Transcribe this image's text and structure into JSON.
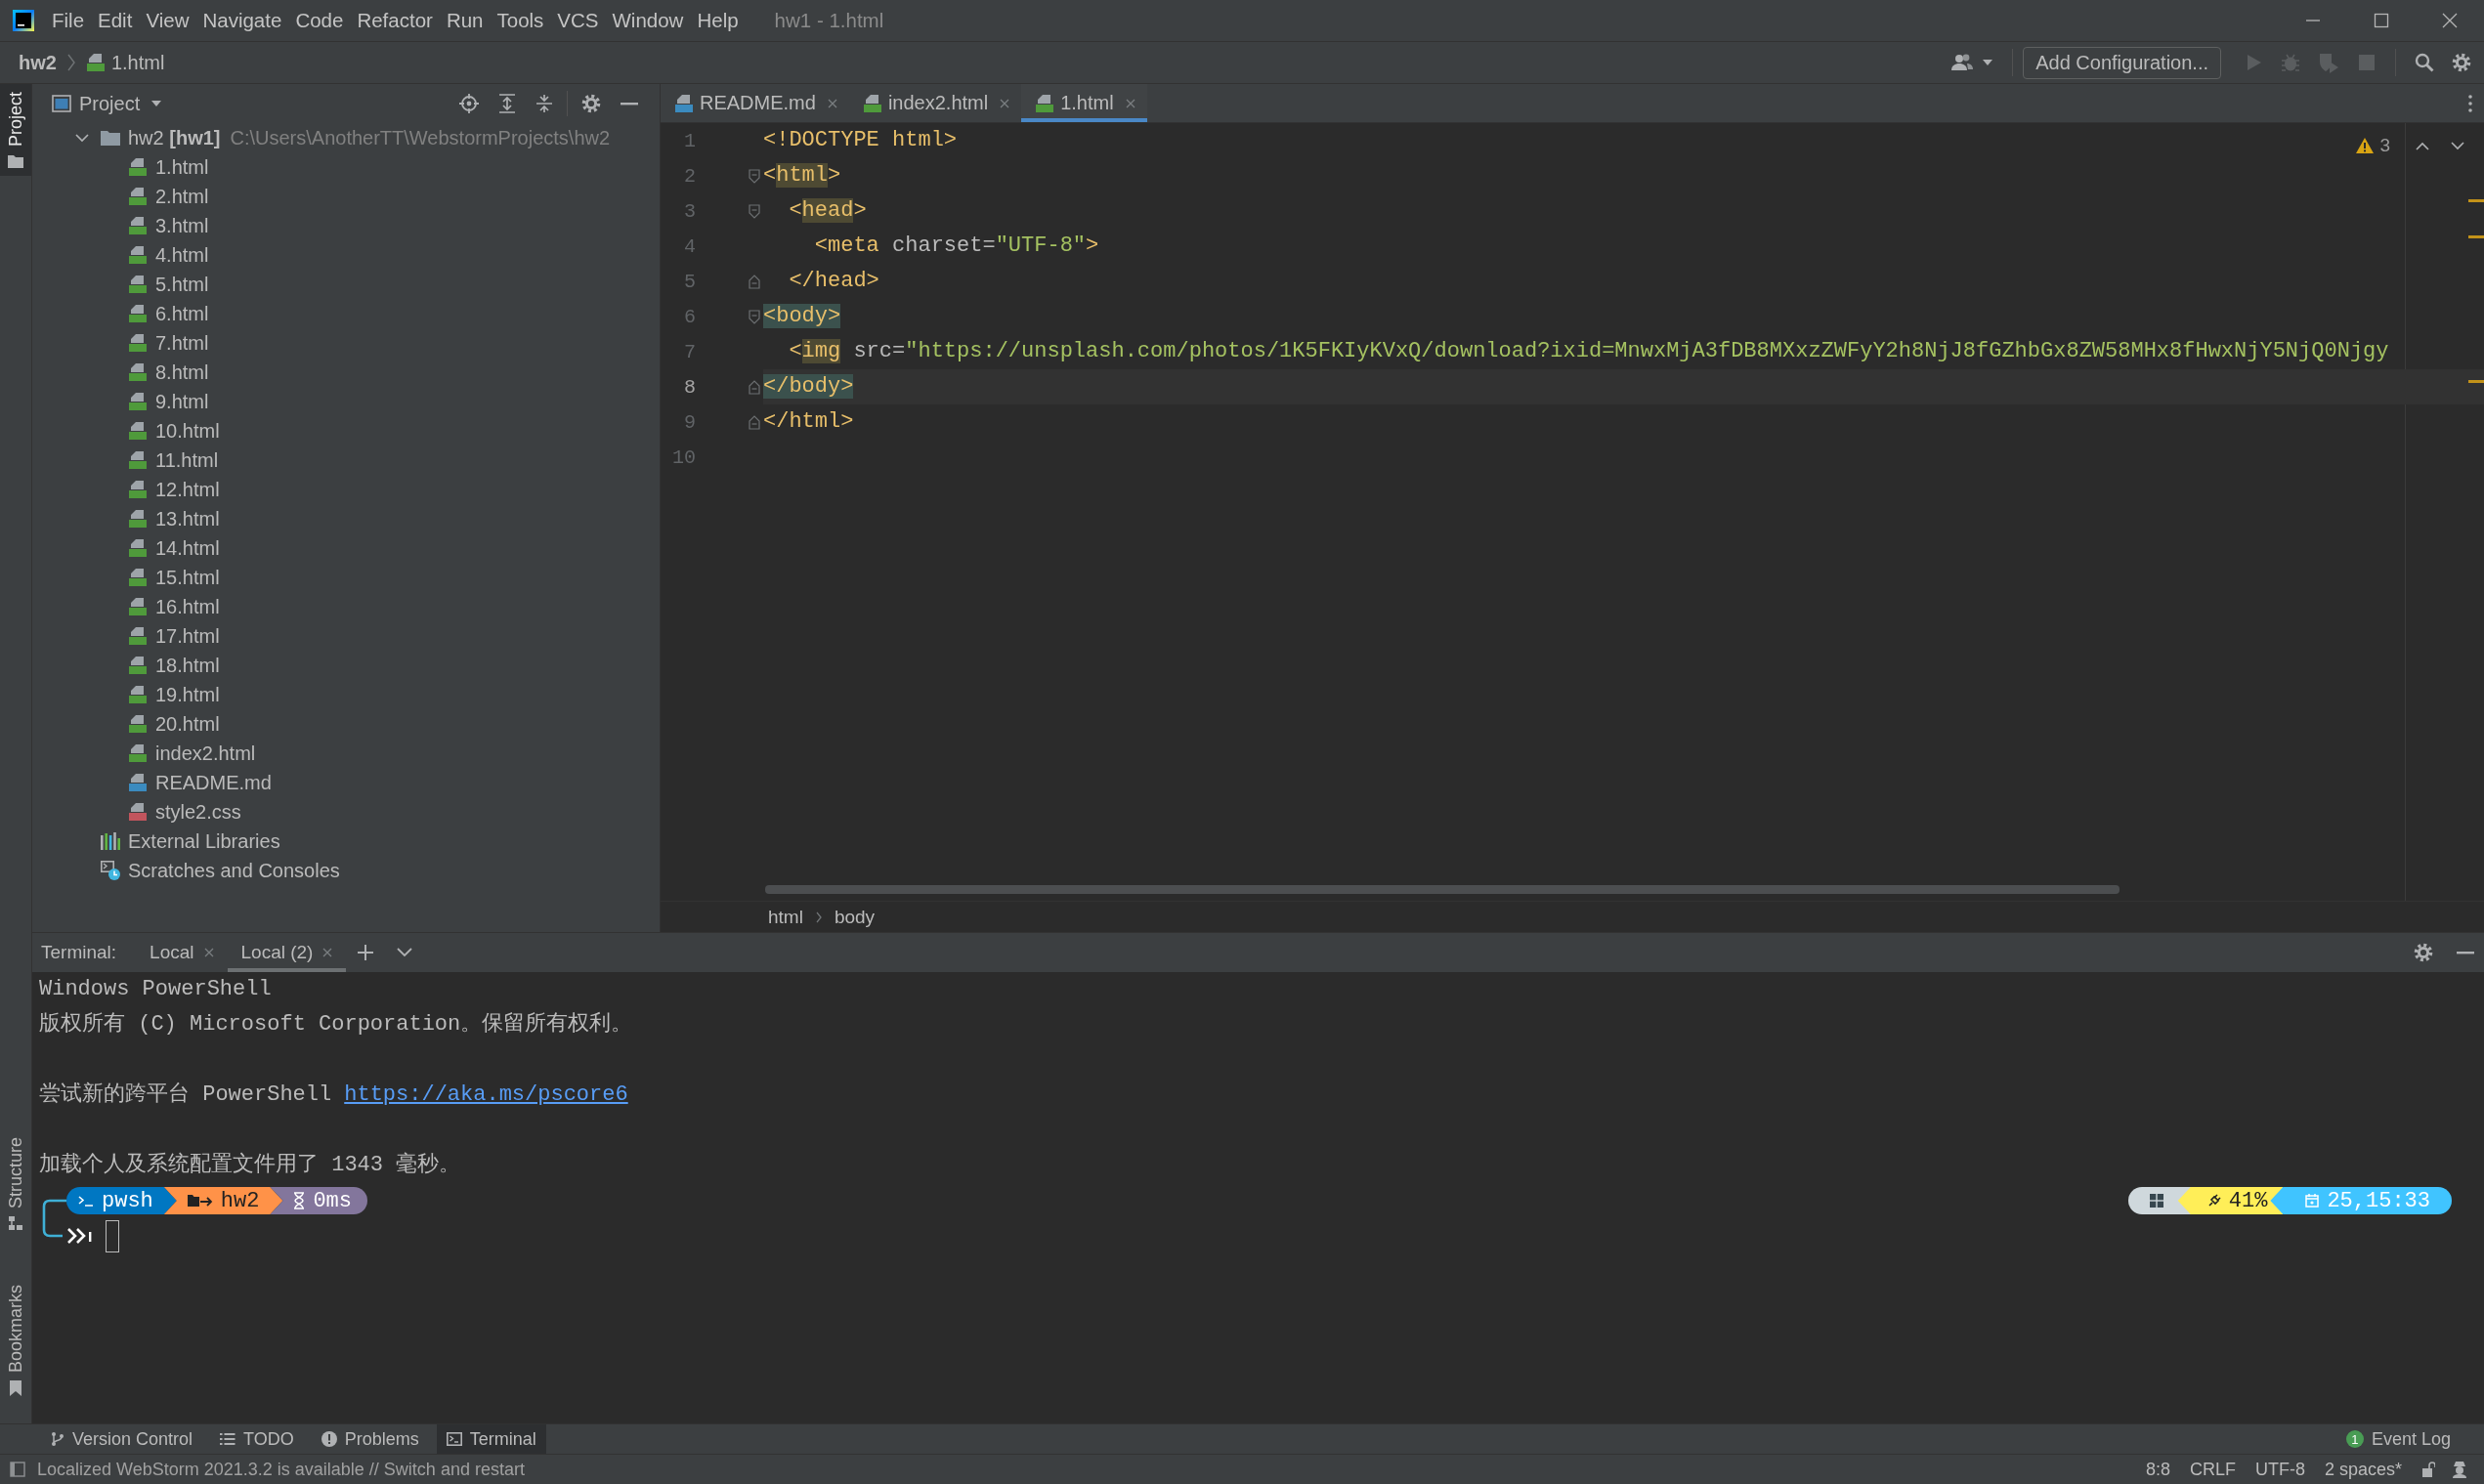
{
  "title_bar": {
    "menus": [
      "File",
      "Edit",
      "View",
      "Navigate",
      "Code",
      "Refactor",
      "Run",
      "Tools",
      "VCS",
      "Window",
      "Help"
    ],
    "title": "hw1 - 1.html"
  },
  "nav_bar": {
    "breadcrumb": [
      {
        "label": "hw2",
        "kind": "project"
      },
      {
        "label": "1.html",
        "kind": "html"
      }
    ],
    "run_configuration": "Add Configuration..."
  },
  "tool_window_stripe": {
    "top": [
      {
        "label": "Project",
        "kind": "project",
        "selected": true
      }
    ],
    "bottom": [
      {
        "label": "Structure",
        "kind": "structure",
        "selected": false
      },
      {
        "label": "Bookmarks",
        "kind": "bookmarks",
        "selected": false
      }
    ]
  },
  "project_panel": {
    "title": "Project",
    "tree": [
      {
        "name": "hw2 **[hw1]**",
        "path": "C:\\Users\\AnotherTT\\WebstormProjects\\hw2",
        "kind": "folder",
        "expanded": true,
        "children": [
          {
            "name": "1.html",
            "kind": "html"
          },
          {
            "name": "2.html",
            "kind": "html"
          },
          {
            "name": "3.html",
            "kind": "html"
          },
          {
            "name": "4.html",
            "kind": "html"
          },
          {
            "name": "5.html",
            "kind": "html"
          },
          {
            "name": "6.html",
            "kind": "html"
          },
          {
            "name": "7.html",
            "kind": "html"
          },
          {
            "name": "8.html",
            "kind": "html"
          },
          {
            "name": "9.html",
            "kind": "html"
          },
          {
            "name": "10.html",
            "kind": "html"
          },
          {
            "name": "11.html",
            "kind": "html"
          },
          {
            "name": "12.html",
            "kind": "html"
          },
          {
            "name": "13.html",
            "kind": "html"
          },
          {
            "name": "14.html",
            "kind": "html"
          },
          {
            "name": "15.html",
            "kind": "html"
          },
          {
            "name": "16.html",
            "kind": "html"
          },
          {
            "name": "17.html",
            "kind": "html"
          },
          {
            "name": "18.html",
            "kind": "html"
          },
          {
            "name": "19.html",
            "kind": "html"
          },
          {
            "name": "20.html",
            "kind": "html"
          },
          {
            "name": "index2.html",
            "kind": "html"
          },
          {
            "name": "README.md",
            "kind": "md"
          },
          {
            "name": "style2.css",
            "kind": "css"
          }
        ]
      },
      {
        "name": "External Libraries",
        "kind": "libraries"
      },
      {
        "name": "Scratches and Consoles",
        "kind": "scratches"
      }
    ]
  },
  "editor": {
    "tabs": [
      {
        "label": "README.md",
        "kind": "md",
        "selected": false
      },
      {
        "label": "index2.html",
        "kind": "html",
        "selected": false
      },
      {
        "label": "1.html",
        "kind": "html",
        "selected": true
      }
    ],
    "warning_count": "3",
    "lines": [
      {
        "number": "1",
        "kind": "plain",
        "current": false,
        "tokens": [
          {
            "text": "<!DOCTYPE html>",
            "kind": "tag"
          }
        ]
      },
      {
        "number": "2",
        "kind": "foldstart",
        "current": false,
        "tokens": [
          {
            "text": "<",
            "kind": "tag"
          },
          {
            "text": "html",
            "kind": "warning"
          },
          {
            "text": ">",
            "kind": "tag"
          }
        ]
      },
      {
        "number": "3",
        "kind": "foldstart",
        "current": false,
        "tokens": [
          {
            "text": "  <",
            "kind": "tag"
          },
          {
            "text": "head",
            "kind": "warning"
          },
          {
            "text": ">",
            "kind": "tag"
          }
        ]
      },
      {
        "number": "4",
        "kind": "plain",
        "current": false,
        "tokens": [
          {
            "text": "    <meta",
            "kind": "tag"
          },
          {
            "text": " charset=",
            "kind": "attr"
          },
          {
            "text": "\"UTF-8\"",
            "kind": "string"
          },
          {
            "text": ">",
            "kind": "tag"
          }
        ]
      },
      {
        "number": "5",
        "kind": "foldend",
        "current": false,
        "tokens": [
          {
            "text": "  </head>",
            "kind": "tag"
          }
        ]
      },
      {
        "number": "6",
        "kind": "foldstart",
        "current": false,
        "tokens": [
          {
            "text": "<body>",
            "kind": "match"
          }
        ]
      },
      {
        "number": "7",
        "kind": "plain",
        "current": false,
        "tokens": [
          {
            "text": "  <",
            "kind": "tag"
          },
          {
            "text": "img",
            "kind": "warning"
          },
          {
            "text": " src=",
            "kind": "attr"
          },
          {
            "text": "\"https://unsplash.com/photos/1K5FKIyKVxQ/download?ixid=MnwxMjA3fDB8MXxzZWFyY2h8NjJ8fGZhbGx8ZW58MHx8fHwxNjY5NjQ0Njgy",
            "kind": "string"
          }
        ]
      },
      {
        "number": "8",
        "kind": "foldend",
        "current": true,
        "tokens": [
          {
            "text": "</body>",
            "kind": "match"
          }
        ]
      },
      {
        "number": "9",
        "kind": "foldend",
        "current": false,
        "tokens": [
          {
            "text": "</html>",
            "kind": "tag"
          }
        ]
      },
      {
        "number": "10",
        "kind": "plain",
        "current": false
      }
    ],
    "breadcrumb": [
      "html",
      "body"
    ]
  },
  "terminal": {
    "label": "Terminal:",
    "tabs": [
      {
        "label": "Local",
        "selected": false
      },
      {
        "label": "Local (2)",
        "selected": true
      }
    ],
    "lines": [
      {
        "kind": "text",
        "text": "Windows PowerShell"
      },
      {
        "kind": "text",
        "text": "版权所有 (C) Microsoft Corporation。保留所有权利。"
      },
      {
        "kind": "blank"
      },
      {
        "kind": "text",
        "text": "尝试新的跨平台 PowerShell",
        "link": "https://aka.ms/pscore6"
      },
      {
        "kind": "blank"
      },
      {
        "kind": "text",
        "text": "加载个人及系统配置文件用了 1343 毫秒。"
      }
    ],
    "prompt": {
      "left": [
        {
          "text": "pwsh",
          "kind": "shell",
          "color": "#0077c2"
        },
        {
          "text": "hw2",
          "kind": "path",
          "color": "#ff9248"
        },
        {
          "text": "0ms",
          "kind": "timer",
          "color": "#83769c"
        }
      ],
      "right": [
        {
          "kind": "os",
          "color": "#cfd8dc"
        },
        {
          "text": "41%",
          "kind": "battery",
          "color": "#ffee58"
        },
        {
          "text": "25,15:33",
          "kind": "time",
          "color": "#40c4ff"
        }
      ]
    }
  },
  "tool_stripe": {
    "items": [
      {
        "label": "Version Control",
        "kind": "vcs",
        "selected": false
      },
      {
        "label": "TODO",
        "kind": "todo",
        "selected": false
      },
      {
        "label": "Problems",
        "kind": "problems",
        "selected": false
      },
      {
        "label": "Terminal",
        "kind": "terminal",
        "selected": true
      }
    ],
    "event_log": {
      "label": "Event Log",
      "count": "1"
    }
  },
  "status_bar": {
    "message": "Localized WebStorm 2021.3.2 is available // Switch and restart",
    "items": [
      "8:8",
      "CRLF",
      "UTF-8",
      "2 spaces*"
    ]
  }
}
